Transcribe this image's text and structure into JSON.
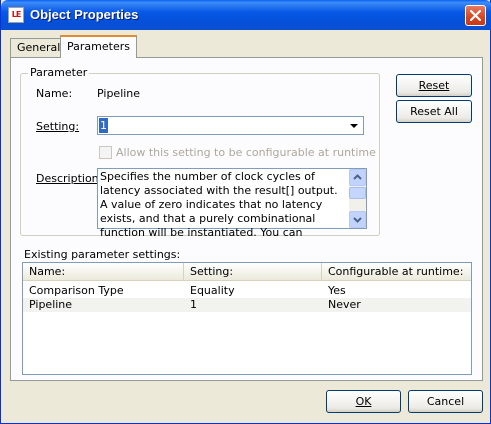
{
  "window": {
    "title": "Object Properties",
    "icon_label": "LE",
    "close_icon": "close-icon",
    "accent": "#0858e6"
  },
  "tabs": [
    {
      "label": "General",
      "active": false
    },
    {
      "label": "Parameters",
      "active": true
    }
  ],
  "parameter": {
    "group_label": "Parameter",
    "name_label": "Name:",
    "name_value": "Pipeline",
    "setting_label": "Setting:",
    "setting_value": "1",
    "checkbox_label": "Allow this setting to be configurable at runtime",
    "checkbox_checked": false,
    "checkbox_enabled": false,
    "description_label": "Description:",
    "description_text": "Specifies the number of clock cycles of latency associated with the result[] output. A value of zero indicates that no latency exists, and that a purely combinational function will be instantiated. You can"
  },
  "side_buttons": {
    "reset": "Reset",
    "reset_all": "Reset All"
  },
  "existing": {
    "label": "Existing parameter settings:",
    "columns": [
      "Name:",
      "Setting:",
      "Configurable at runtime:"
    ],
    "rows": [
      {
        "name": "Comparison Type",
        "setting": "Equality",
        "configurable": "Yes"
      },
      {
        "name": "Pipeline",
        "setting": "1",
        "configurable": "Never"
      }
    ]
  },
  "footer": {
    "ok": "OK",
    "cancel": "Cancel"
  }
}
